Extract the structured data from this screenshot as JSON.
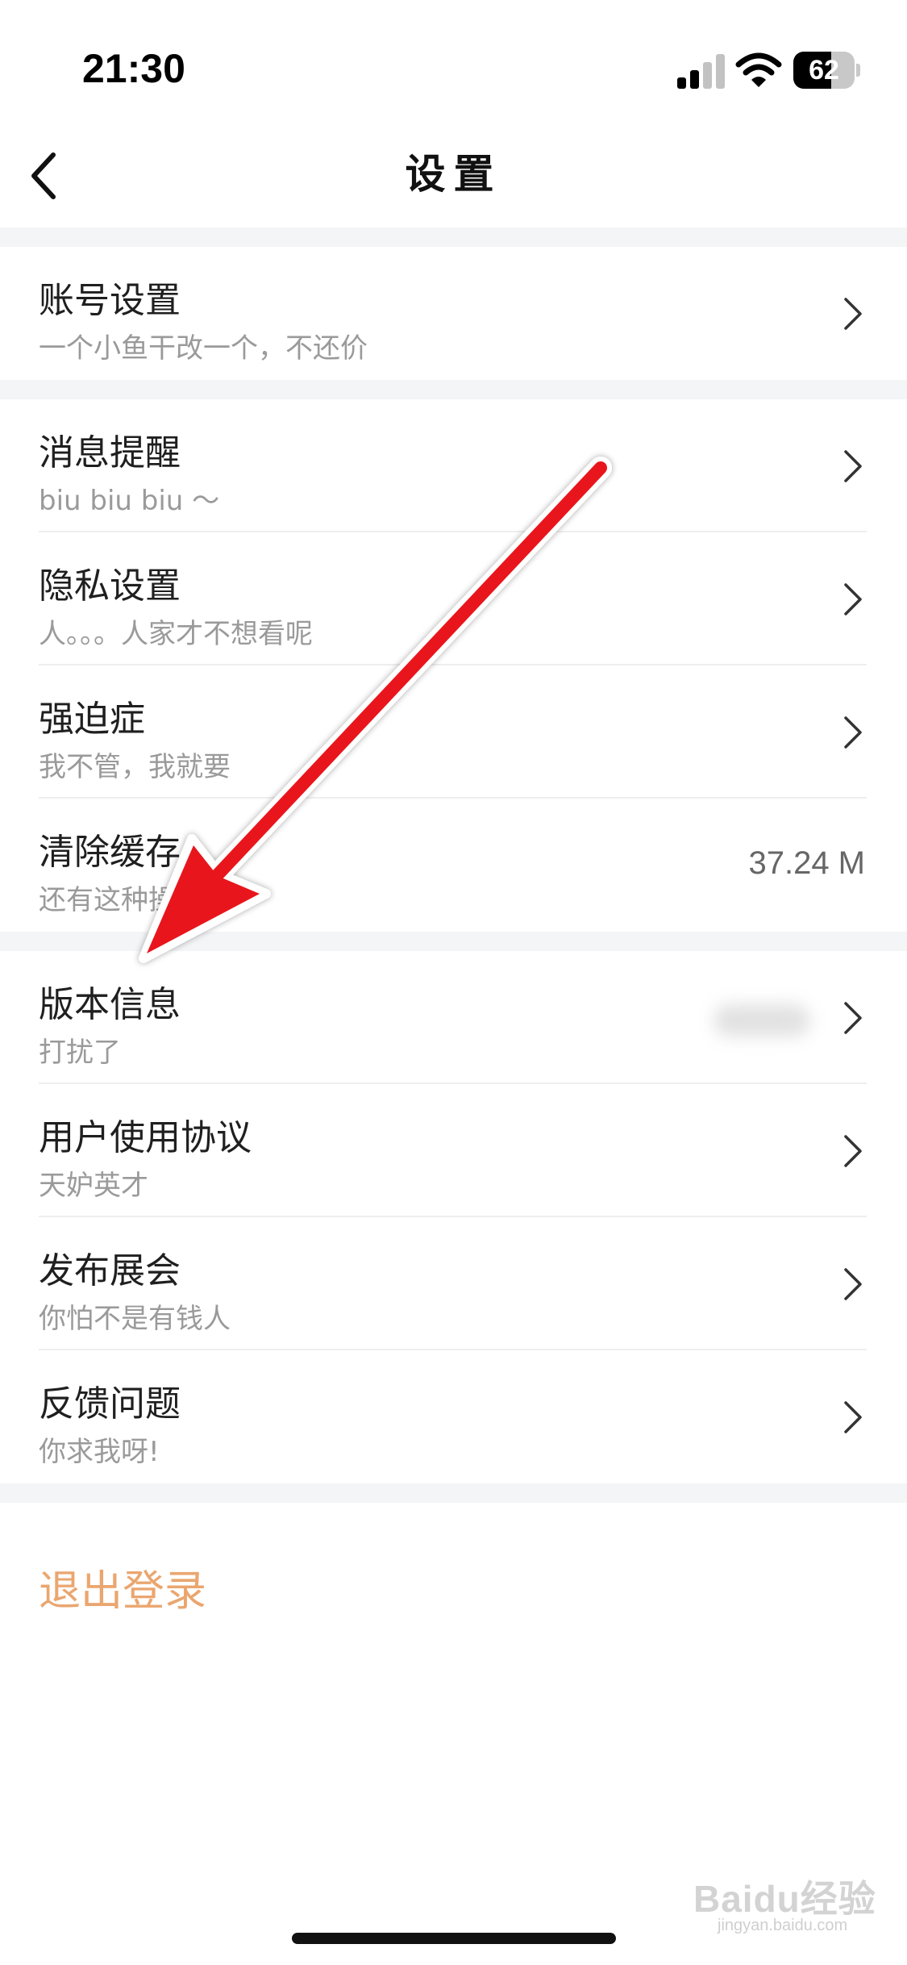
{
  "status_bar": {
    "time": "21:30",
    "battery_level": "62",
    "battery_fraction": 0.62,
    "icons": [
      "signal-icon",
      "wifi-icon",
      "battery-icon"
    ]
  },
  "nav": {
    "back_icon": "chevron-left-icon",
    "title": "设置"
  },
  "groups": [
    {
      "items": [
        {
          "title": "账号设置",
          "subtitle": "一个小鱼干改一个，不还价",
          "accessory": "chevron"
        }
      ]
    },
    {
      "items": [
        {
          "title": "消息提醒",
          "subtitle": "biu biu biu ～",
          "accessory": "chevron"
        },
        {
          "title": "隐私设置",
          "subtitle": "人。。。人家才不想看呢",
          "accessory": "chevron"
        },
        {
          "title": "强迫症",
          "subtitle": "我不管，我就要",
          "accessory": "chevron"
        },
        {
          "title": "清除缓存",
          "subtitle": "还有这种操作",
          "accessory": "value",
          "value": "37.24 M"
        }
      ]
    },
    {
      "items": [
        {
          "title": "版本信息",
          "subtitle": "打扰了",
          "accessory": "chevron",
          "value_blurred": true
        },
        {
          "title": "用户使用协议",
          "subtitle": "天妒英才",
          "accessory": "chevron"
        },
        {
          "title": "发布展会",
          "subtitle": "你怕不是有钱人",
          "accessory": "chevron"
        },
        {
          "title": "反馈问题",
          "subtitle": "你求我呀!",
          "accessory": "chevron"
        }
      ]
    }
  ],
  "logout_label": "退出登录",
  "watermark": {
    "text": "Baidu经验",
    "sub": "jingyan.baidu.com"
  },
  "colors": {
    "accent_logout": "#eaa66f",
    "annotation_arrow": "#e8141b",
    "group_gap": "#f4f5f7",
    "subtitle": "#9a9a9a"
  }
}
